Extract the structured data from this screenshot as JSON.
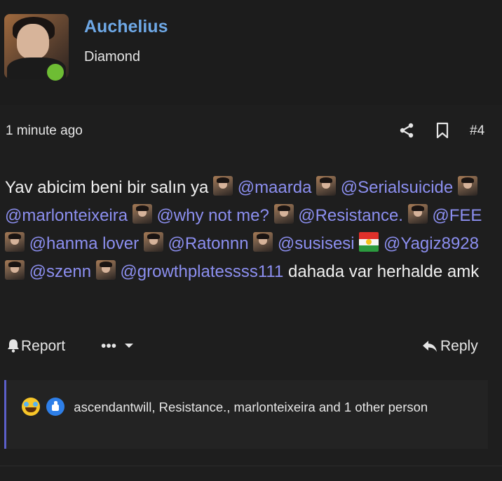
{
  "post": {
    "author": "Auchelius",
    "rank": "Diamond",
    "time": "1 minute ago",
    "number": "#4",
    "message": {
      "intro": "Yav abicim beni bir salın ya",
      "mentions": [
        "@maarda",
        "@Serialsuicide",
        "@marlonteixeira",
        "@why not me?",
        "@Resistance.",
        "@FEE",
        "@hanma lover",
        "@Ratonnn",
        "@susisesi",
        "@Yagiz8928",
        "@szenn",
        "@growthplatessss111"
      ],
      "outro": "dahada var herhalde amk"
    },
    "actions": {
      "report": "Report",
      "more": "•••",
      "reply": "Reply"
    },
    "reactions": {
      "icons": [
        "haha-reaction-icon",
        "like-reaction-icon"
      ],
      "text": "ascendantwill, Resistance., marlonteixeira and 1 other person"
    }
  },
  "colors": {
    "username": "#6ea8e6",
    "mention": "#8c8ff0",
    "online": "#6ebd34",
    "accent_border": "#5b5fc9"
  }
}
